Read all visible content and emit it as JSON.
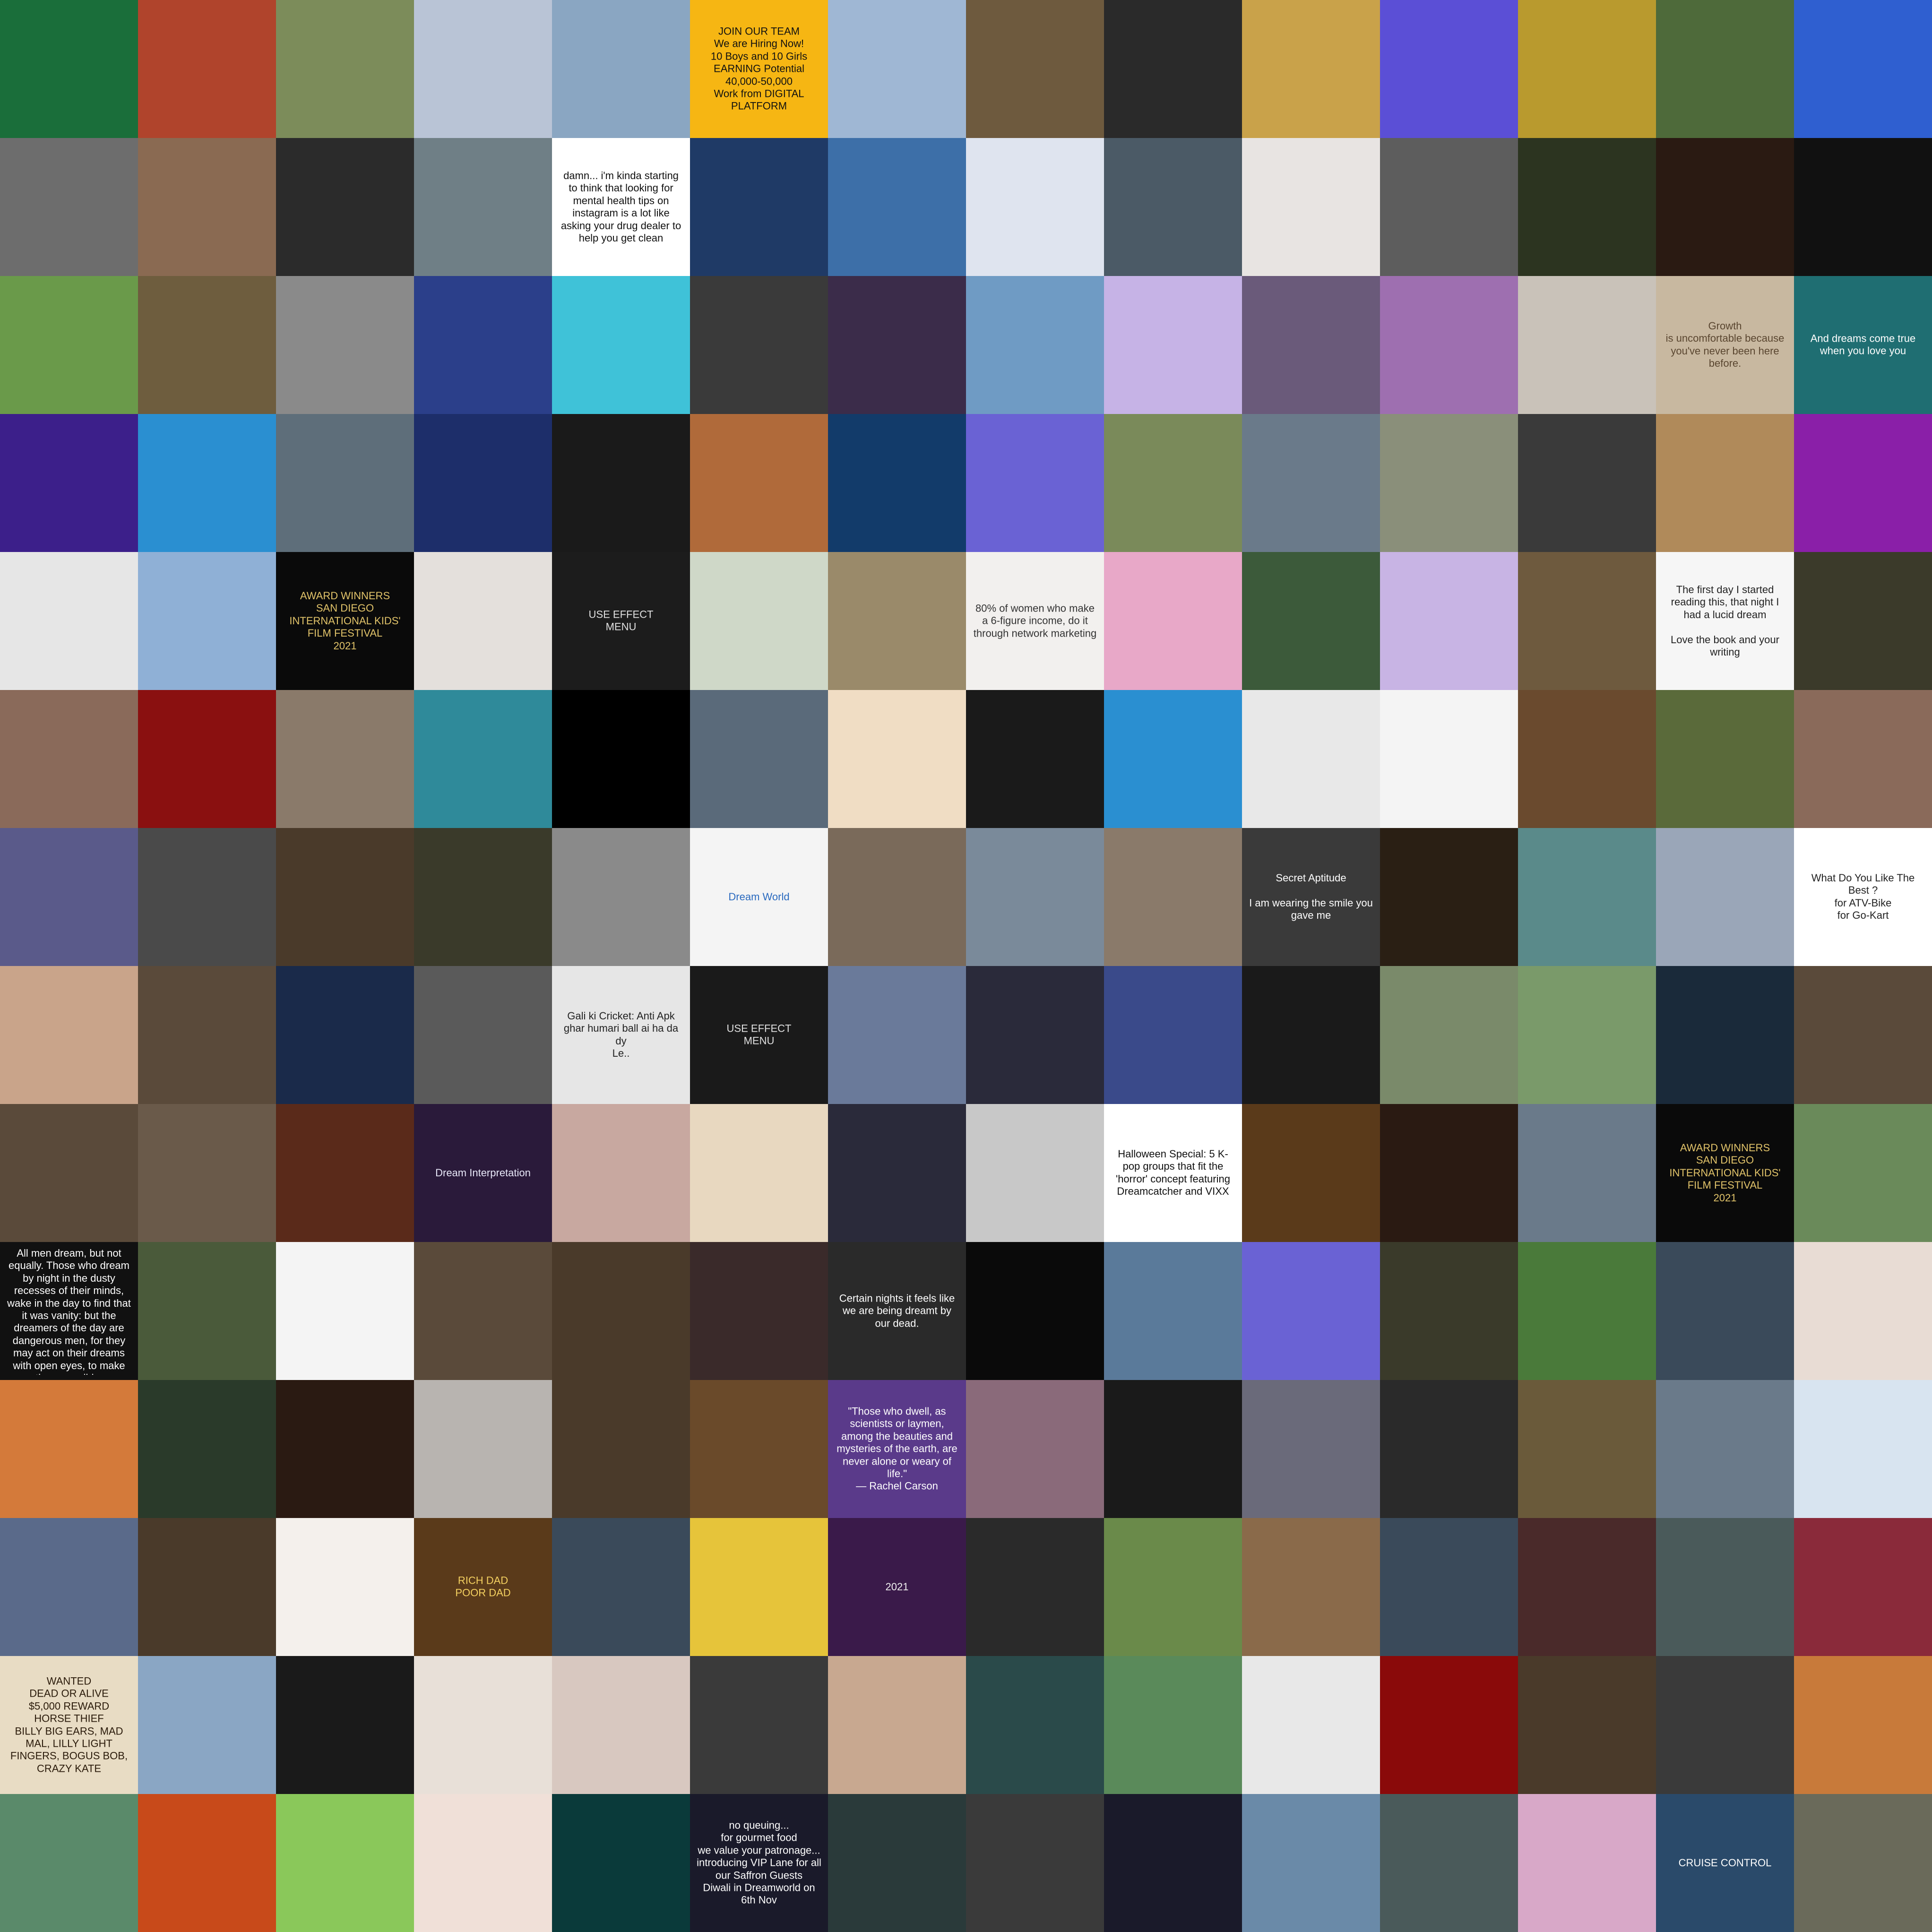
{
  "mosaic": {
    "columns": 14,
    "rows": 14,
    "tiles": [
      {
        "c": "#1a6e3a"
      },
      {
        "c": "#b0442c"
      },
      {
        "c": "#7c8c5a"
      },
      {
        "c": "#b9c4d6"
      },
      {
        "c": "#8aa6c2"
      },
      {
        "c": "#f6b613",
        "text": "JOIN OUR TEAM\nWe are Hiring Now!\n10 Boys and 10 Girls\nEARNING Potential 40,000-50,000\nWork from DIGITAL PLATFORM",
        "t": "#111111"
      },
      {
        "c": "#9fb7d4"
      },
      {
        "c": "#6e5a3e"
      },
      {
        "c": "#2a2a2a"
      },
      {
        "c": "#c9a24a"
      },
      {
        "c": "#5b4fd6"
      },
      {
        "c": "#b99a2e"
      },
      {
        "c": "#4e6a3a"
      },
      {
        "c": "#2f5fd0"
      },
      {
        "c": "#6d6d6d"
      },
      {
        "c": "#8a6a52"
      },
      {
        "c": "#2b2b2b"
      },
      {
        "c": "#6f7f86"
      },
      {
        "c": "#ffffff",
        "text": "damn... i'm kinda starting to think that looking for mental health tips on instagram is a lot like asking your drug dealer to help you get clean",
        "t": "#111111"
      },
      {
        "c": "#1f3a66"
      },
      {
        "c": "#3d6fa8"
      },
      {
        "c": "#dfe4ef"
      },
      {
        "c": "#4b5a66"
      },
      {
        "c": "#e8e4e2"
      },
      {
        "c": "#5d5d5d"
      },
      {
        "c": "#2c3420"
      },
      {
        "c": "#2a1a12"
      },
      {
        "c": "#111111"
      },
      {
        "c": "#6a9a4a"
      },
      {
        "c": "#6e5d3e"
      },
      {
        "c": "#8a8a8a"
      },
      {
        "c": "#2b3f8a"
      },
      {
        "c": "#3fc2d8"
      },
      {
        "c": "#3a3a3a"
      },
      {
        "c": "#3b2c4a"
      },
      {
        "c": "#6f9bc4"
      },
      {
        "c": "#c6b3e6"
      },
      {
        "c": "#6a5a7a"
      },
      {
        "c": "#9e6fb0"
      },
      {
        "c": "#c9c2b9"
      },
      {
        "c": "#c8b8a0",
        "text": "Growth\nis uncomfortable because you've never been here before.",
        "t": "#5a4630"
      },
      {
        "c": "#1f6e72",
        "text": "And dreams come true when you love you",
        "t": "#ffffff"
      },
      {
        "c": "#3c1f8a"
      },
      {
        "c": "#2a8fd1"
      },
      {
        "c": "#5e6e7a"
      },
      {
        "c": "#1d2e6a"
      },
      {
        "c": "#1a1a1a"
      },
      {
        "c": "#b06a3a"
      },
      {
        "c": "#123b6a"
      },
      {
        "c": "#6a62d4"
      },
      {
        "c": "#7a8a5a"
      },
      {
        "c": "#6a7a8a"
      },
      {
        "c": "#8a8f7a"
      },
      {
        "c": "#3a3a3a"
      },
      {
        "c": "#b08a5a"
      },
      {
        "c": "#8a1fa8"
      },
      {
        "c": "#e6e6e6"
      },
      {
        "c": "#8fb0d6"
      },
      {
        "c": "#0a0a0a",
        "text": "AWARD WINNERS\nSAN DIEGO INTERNATIONAL KIDS' FILM FESTIVAL\n2021",
        "t": "#e2c46a"
      },
      {
        "c": "#e4e0dc"
      },
      {
        "c": "#1c1c1c",
        "text": "USE EFFECT\nMENU",
        "t": "#e0e0e0"
      },
      {
        "c": "#cfd8c8"
      },
      {
        "c": "#9a8a6a"
      },
      {
        "c": "#f2f0ee",
        "text": "80% of women who make a 6-figure income, do it through network marketing",
        "t": "#333333"
      },
      {
        "c": "#e8a8c8"
      },
      {
        "c": "#3c5a3a"
      },
      {
        "c": "#c8b4e4"
      },
      {
        "c": "#6e5a3e"
      },
      {
        "c": "#f6f6f6",
        "text": "The first day I started reading this, that night I had a lucid dream\n\nLove the book and your writing",
        "t": "#222222"
      },
      {
        "c": "#3b3a2a"
      },
      {
        "c": "#8a6a5a"
      },
      {
        "c": "#8a1010"
      },
      {
        "c": "#8a7a6a"
      },
      {
        "c": "#2f8a9a"
      },
      {
        "c": "#000000"
      },
      {
        "c": "#5a6a7a"
      },
      {
        "c": "#f0ddc4"
      },
      {
        "c": "#1a1a1a"
      },
      {
        "c": "#2a8fd1"
      },
      {
        "c": "#e8e8e8"
      },
      {
        "c": "#f4f4f4"
      },
      {
        "c": "#6a4a2e"
      },
      {
        "c": "#5a6a3a"
      },
      {
        "c": "#8a6a5a"
      },
      {
        "c": "#5a5a8a"
      },
      {
        "c": "#4a4a4a"
      },
      {
        "c": "#4a3a2a"
      },
      {
        "c": "#3a3a2a"
      },
      {
        "c": "#8a8a8a"
      },
      {
        "c": "#f4f4f4",
        "text": "Dream World",
        "t": "#2a6abf"
      },
      {
        "c": "#7a6a5a"
      },
      {
        "c": "#7a8a9a"
      },
      {
        "c": "#8a7a6a"
      },
      {
        "c": "#3a3a3a",
        "text": "Secret Aptitude\n\nI am wearing the smile you gave me",
        "t": "#ffffff"
      },
      {
        "c": "#2a1f14"
      },
      {
        "c": "#5a8a8a"
      },
      {
        "c": "#9aa6b8"
      },
      {
        "c": "#ffffff",
        "text": "What Do You Like The Best ?\nfor ATV-Bike\nfor Go-Kart",
        "t": "#222222"
      },
      {
        "c": "#c9a48a"
      },
      {
        "c": "#5a4a3a"
      },
      {
        "c": "#1a2a4a"
      },
      {
        "c": "#5a5a5a"
      },
      {
        "c": "#e6e6e6",
        "text": "Gali ki Cricket: Anti Apk ghar humari ball ai ha da dy\nLe..",
        "t": "#222222"
      },
      {
        "c": "#1a1a1a",
        "text": "USE EFFECT\nMENU",
        "t": "#e0e0e0"
      },
      {
        "c": "#6a7a9a"
      },
      {
        "c": "#2a2a3a"
      },
      {
        "c": "#3a4a8a"
      },
      {
        "c": "#1a1a1a"
      },
      {
        "c": "#7a8a6a"
      },
      {
        "c": "#7a9a6a"
      },
      {
        "c": "#1a2a3a"
      },
      {
        "c": "#5a4a3a"
      },
      {
        "c": "#5a4a3a"
      },
      {
        "c": "#6a5a4a"
      },
      {
        "c": "#5a2a1a"
      },
      {
        "c": "#2a1a3a",
        "text": "Dream Interpretation",
        "t": "#e8e8f8"
      },
      {
        "c": "#c8a8a0"
      },
      {
        "c": "#e8d8c0"
      },
      {
        "c": "#2a2a3a"
      },
      {
        "c": "#c8c8c8"
      },
      {
        "c": "#ffffff",
        "text": "Halloween Special: 5 K-pop groups that fit the 'horror' concept featuring Dreamcatcher and VIXX",
        "t": "#111111"
      },
      {
        "c": "#5a3a1a"
      },
      {
        "c": "#2a1a12"
      },
      {
        "c": "#6a7a8a"
      },
      {
        "c": "#0a0a0a",
        "text": "AWARD WINNERS\nSAN DIEGO INTERNATIONAL KIDS' FILM FESTIVAL\n2021",
        "t": "#e2c46a"
      },
      {
        "c": "#6a8a5a"
      },
      {
        "c": "#111111",
        "text": "All men dream, but not equally. Those who dream by night in the dusty recesses of their minds, wake in the day to find that it was vanity: but the dreamers of the day are dangerous men, for they may act on their dreams with open eyes, to make them possible.",
        "t": "#ffffff"
      },
      {
        "c": "#4a5a3a"
      },
      {
        "c": "#f4f4f4"
      },
      {
        "c": "#5a4a3a"
      },
      {
        "c": "#4a3a2a"
      },
      {
        "c": "#3a2a2a"
      },
      {
        "c": "#2a2a2a",
        "text": "Certain nights it feels like we are being dreamt by our dead.",
        "t": "#ffffff"
      },
      {
        "c": "#0a0a0a"
      },
      {
        "c": "#5a7a9a"
      },
      {
        "c": "#6a62d4"
      },
      {
        "c": "#3a3a2a"
      },
      {
        "c": "#4a7a3a"
      },
      {
        "c": "#3a4a5a"
      },
      {
        "c": "#e8dcd4"
      },
      {
        "c": "#d47a3a"
      },
      {
        "c": "#2a3a2a"
      },
      {
        "c": "#2a1a12"
      },
      {
        "c": "#b8b4b0"
      },
      {
        "c": "#4a3a2a"
      },
      {
        "c": "#6a4a2a"
      },
      {
        "c": "#5a3a8a",
        "text": "\"Those who dwell, as scientists or laymen, among the beauties and mysteries of the earth, are never alone or weary of life.\"\n— Rachel Carson",
        "t": "#ffffff"
      },
      {
        "c": "#8a6a7a"
      },
      {
        "c": "#1a1a1a"
      },
      {
        "c": "#6a6a7a"
      },
      {
        "c": "#2a2a2a"
      },
      {
        "c": "#6a5a3a"
      },
      {
        "c": "#6a7a8a"
      },
      {
        "c": "#d8e4f0"
      },
      {
        "c": "#5a6a8a"
      },
      {
        "c": "#4a3a2a"
      },
      {
        "c": "#f4f0ec"
      },
      {
        "c": "#5a3a1a",
        "text": "RICH DAD\nPOOR DAD",
        "t": "#f4d060"
      },
      {
        "c": "#3a4a5a"
      },
      {
        "c": "#e6c43a"
      },
      {
        "c": "#3a1a4a",
        "text": "2021",
        "t": "#f0f0f0"
      },
      {
        "c": "#2a2a2a"
      },
      {
        "c": "#6a8a4a"
      },
      {
        "c": "#8a6a4a"
      },
      {
        "c": "#3a4a5a"
      },
      {
        "c": "#4a2a2a"
      },
      {
        "c": "#4a5a5a"
      },
      {
        "c": "#8a2a3a"
      },
      {
        "c": "#e8dcc4",
        "text": "WANTED\nDEAD OR ALIVE\n$5,000 REWARD\nHORSE THIEF\nBILLY BIG EARS, MAD MAL, LILLY LIGHT FINGERS, BOGUS BOB, CRAZY KATE",
        "t": "#2a1a0a"
      },
      {
        "c": "#8aa6c4"
      },
      {
        "c": "#1a1a1a"
      },
      {
        "c": "#e8e0d8"
      },
      {
        "c": "#d8c8c0"
      },
      {
        "c": "#3a3a3a"
      },
      {
        "c": "#c8a890"
      },
      {
        "c": "#2a4a4a"
      },
      {
        "c": "#5a8a5a"
      },
      {
        "c": "#e8e8e8"
      },
      {
        "c": "#8a0a0a"
      },
      {
        "c": "#4a3a2a"
      },
      {
        "c": "#3a3a3a"
      },
      {
        "c": "#c87a3a"
      },
      {
        "c": "#5a8a6a"
      },
      {
        "c": "#c84a1a"
      },
      {
        "c": "#8ac85a"
      },
      {
        "c": "#f0e0d8"
      },
      {
        "c": "#0a3a3a"
      },
      {
        "c": "#1a1a2a",
        "text": "no queuing...\nfor gourmet food\nwe value your patronage... introducing VIP Lane for all our Saffron Guests\nDiwali in Dreamworld on 6th Nov",
        "t": "#ffffff"
      },
      {
        "c": "#2a3a3a"
      },
      {
        "c": "#3a3a3a"
      },
      {
        "c": "#1a1a2a"
      },
      {
        "c": "#6a8aa8"
      },
      {
        "c": "#4a5a5a"
      },
      {
        "c": "#d8a8c8"
      },
      {
        "c": "#2a4a6a",
        "text": "CRUISE CONTROL",
        "t": "#ffffff"
      },
      {
        "c": "#6a6a5a"
      }
    ]
  }
}
